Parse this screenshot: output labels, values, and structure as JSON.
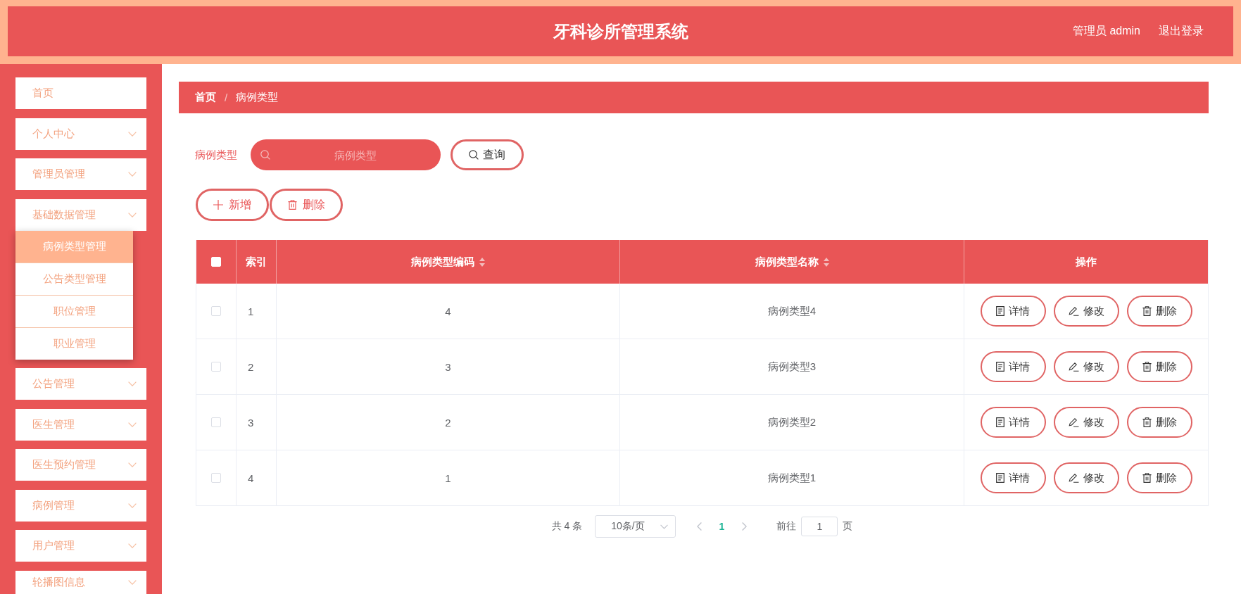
{
  "header": {
    "title": "牙科诊所管理系统",
    "user": "管理员 admin",
    "logout": "退出登录"
  },
  "sidebar": {
    "items": [
      {
        "kind": "link",
        "label": "首页"
      },
      {
        "kind": "submenu",
        "label": "个人中心"
      },
      {
        "kind": "submenu",
        "label": "管理员管理"
      },
      {
        "kind": "submenu",
        "label": "基础数据管理",
        "children": [
          {
            "label": "病例类型管理",
            "selected": true
          },
          {
            "label": "公告类型管理",
            "selected": false
          },
          {
            "label": "职位管理",
            "selected": false
          },
          {
            "label": "职业管理",
            "selected": false
          }
        ]
      },
      {
        "kind": "submenu",
        "label": "公告管理"
      },
      {
        "kind": "submenu",
        "label": "医生管理"
      },
      {
        "kind": "submenu",
        "label": "医生预约管理"
      },
      {
        "kind": "submenu",
        "label": "病例管理"
      },
      {
        "kind": "submenu",
        "label": "用户管理"
      },
      {
        "kind": "submenu",
        "label": "轮播图信息"
      }
    ]
  },
  "breadcrumb": {
    "separator": "/",
    "items": [
      {
        "label": "首页",
        "link": true
      },
      {
        "label": "病例类型",
        "link": false
      }
    ]
  },
  "search": {
    "label": "病例类型",
    "placeholder": "病例类型",
    "button": "查询"
  },
  "actions": [
    {
      "kind": "add",
      "label": "新增"
    },
    {
      "kind": "delete",
      "label": "删除"
    }
  ],
  "table": {
    "select_all": {
      "checked": false
    },
    "columns": [
      {
        "label": "索引",
        "sortable": false
      },
      {
        "label": "病例类型编码",
        "sortable": true
      },
      {
        "label": "病例类型名称",
        "sortable": true
      },
      {
        "label": "操作",
        "sortable": false
      }
    ],
    "rows": [
      {
        "checked": false,
        "index": "1",
        "code": "4",
        "name": "病例类型4",
        "actions": [
          {
            "kind": "detail",
            "label": "详情"
          },
          {
            "kind": "edit",
            "label": "修改"
          },
          {
            "kind": "delete",
            "label": "删除"
          }
        ]
      },
      {
        "checked": false,
        "index": "2",
        "code": "3",
        "name": "病例类型3",
        "actions": [
          {
            "kind": "detail",
            "label": "详情"
          },
          {
            "kind": "edit",
            "label": "修改"
          },
          {
            "kind": "delete",
            "label": "删除"
          }
        ]
      },
      {
        "checked": false,
        "index": "3",
        "code": "2",
        "name": "病例类型2",
        "actions": [
          {
            "kind": "detail",
            "label": "详情"
          },
          {
            "kind": "edit",
            "label": "修改"
          },
          {
            "kind": "delete",
            "label": "删除"
          }
        ]
      },
      {
        "checked": false,
        "index": "4",
        "code": "1",
        "name": "病例类型1",
        "actions": [
          {
            "kind": "detail",
            "label": "详情"
          },
          {
            "kind": "edit",
            "label": "修改"
          },
          {
            "kind": "delete",
            "label": "删除"
          }
        ]
      }
    ]
  },
  "pagination": {
    "total": "共 4 条",
    "page_size": "10条/页",
    "pages": [
      {
        "label": "1",
        "selected": true
      }
    ],
    "goto_label": "前往",
    "goto_value": "1",
    "goto_suffix": "页"
  }
}
